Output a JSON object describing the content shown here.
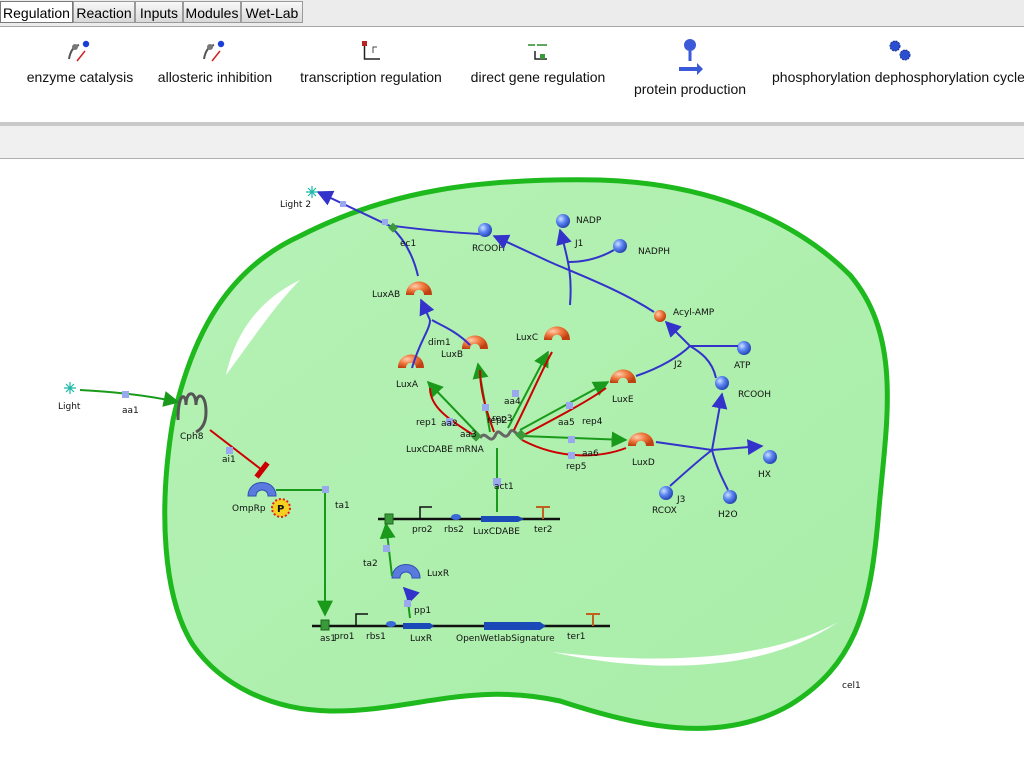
{
  "tabs": [
    "Regulation",
    "Reaction",
    "Inputs",
    "Modules",
    "Wet-Lab"
  ],
  "toolbar": {
    "enzyme_catalysis": "enzyme catalysis",
    "allosteric_inhibition": "allosteric inhibition",
    "transcription_regulation": "transcription regulation",
    "direct_gene_regulation": "direct gene regulation",
    "protein_production": "protein production",
    "phosphorylation_cycle": "phosphorylation dephosphorylation cycle"
  },
  "diagram": {
    "light2": "Light 2",
    "light": "Light",
    "cph8": "Cph8",
    "ompr": "OmpRp",
    "p_badge": "P",
    "luxr": "LuxR",
    "luxab": "LuxAB",
    "luxa": "LuxA",
    "luxb": "LuxB",
    "luxc": "LuxC",
    "luxd": "LuxD",
    "luxe": "LuxE",
    "mrna": "LuxCDABE mRNA",
    "rcooh1": "RCOOH",
    "rcooh2": "RCOOH",
    "nadp": "NADP",
    "nadph": "NADPH",
    "acylamp": "Acyl-AMP",
    "atp": "ATP",
    "hx": "HX",
    "rcox": "RCOX",
    "h2o": "H2O",
    "j1": "J1",
    "j2": "J2",
    "j3": "J3",
    "dim1": "dim1",
    "ec1": "ec1",
    "aa1": "aa1",
    "ai1": "ai1",
    "ta1": "ta1",
    "ta2": "ta2",
    "pp1": "pp1",
    "act1": "act1",
    "aa2": "aa2",
    "aa3": "aa3",
    "aa4": "aa4",
    "aa5": "aa5",
    "aa6": "aa6",
    "rep1": "rep1",
    "rep2": "rep2",
    "rep3": "rep3",
    "rep4": "rep4",
    "rep5": "rep5",
    "pro1": "pro1",
    "pro2": "pro2",
    "rbs1": "rbs1",
    "rbs2": "rbs2",
    "luxr_gene": "LuxR",
    "luxcdabe_gene": "LuxCDABE",
    "openwetlab": "OpenWetlabSignature",
    "ter1": "ter1",
    "ter2": "ter2",
    "cell": "cel1",
    "as1": "as1"
  }
}
